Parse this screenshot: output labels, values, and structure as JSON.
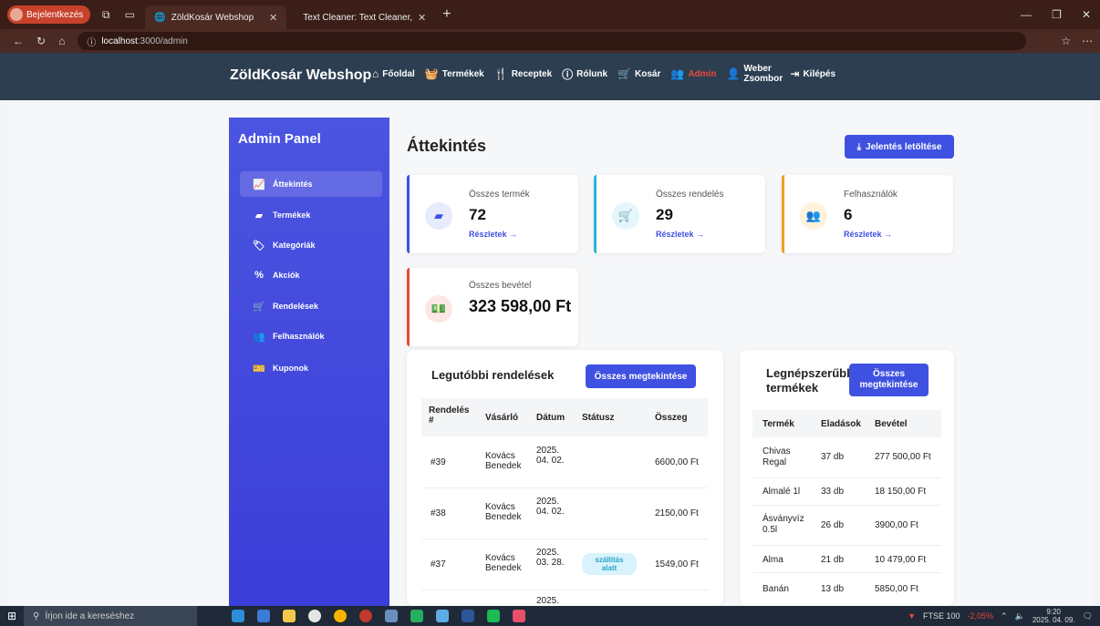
{
  "browser": {
    "profile_label": "Bejelentkezés",
    "tabs": [
      {
        "title": "ZöldKosár Webshop",
        "active": true
      },
      {
        "title": "Text Cleaner: Text Cleaner, Text Fo",
        "active": false
      }
    ],
    "url_host": "localhost",
    "url_path": ":3000/admin"
  },
  "navbar": {
    "brand": "ZöldKosár Webshop",
    "links": [
      {
        "label": "Főoldal",
        "icon": "home-icon"
      },
      {
        "label": "Termékek",
        "icon": "basket-icon"
      },
      {
        "label": "Receptek",
        "icon": "utensils-icon"
      },
      {
        "label": "Rólunk",
        "icon": "info-icon"
      },
      {
        "label": "Kosár",
        "icon": "cart-icon"
      },
      {
        "label": "Admin",
        "icon": "users-cog-icon"
      },
      {
        "label": "Weber Zsombor",
        "icon": "user-icon"
      },
      {
        "label": "Kilépés",
        "icon": "logout-icon"
      }
    ],
    "admin_color": "#e74c3c"
  },
  "sidebar": {
    "title": "Admin Panel",
    "items": [
      {
        "label": "Áttekintés",
        "icon": "chart-line-icon",
        "active": true
      },
      {
        "label": "Termékek",
        "icon": "box-icon",
        "active": false
      },
      {
        "label": "Kategóriák",
        "icon": "tags-icon",
        "active": false
      },
      {
        "label": "Akciók",
        "icon": "percent-icon",
        "active": false
      },
      {
        "label": "Rendelések",
        "icon": "cart-icon",
        "active": false
      },
      {
        "label": "Felhasználók",
        "icon": "users-icon",
        "active": false
      },
      {
        "label": "Kuponok",
        "icon": "ticket-icon",
        "active": false
      }
    ]
  },
  "main": {
    "title": "Áttekintés",
    "report_button": "Jelentés letöltése",
    "stats": [
      {
        "label": "Összes termék",
        "value": "72",
        "link": "Részletek →",
        "color": "#3f51e0",
        "icon": "box-icon"
      },
      {
        "label": "Összes rendelés",
        "value": "29",
        "link": "Részletek →",
        "color": "#2bb6d9",
        "icon": "cart-icon"
      },
      {
        "label": "Felhasználók",
        "value": "6",
        "link": "Részletek →",
        "color": "#f0a020",
        "icon": "users-icon"
      },
      {
        "label": "Összes bevétel",
        "value": "323 598,00 Ft",
        "color": "#e74c3c",
        "icon": "money-icon"
      }
    ]
  },
  "recent_orders": {
    "title": "Legutóbbi rendelések",
    "button": "Összes megtekintése",
    "columns": [
      "Rendelés #",
      "Vásárló",
      "Dátum",
      "Státusz",
      "Összeg"
    ],
    "rows": [
      {
        "id": "#39",
        "customer": "Kovács Benedek",
        "date": "2025. 04. 02.",
        "status": "",
        "amount": "6600,00 Ft"
      },
      {
        "id": "#38",
        "customer": "Kovács Benedek",
        "date": "2025. 04. 02.",
        "status": "",
        "amount": "2150,00 Ft"
      },
      {
        "id": "#37",
        "customer": "Kovács Benedek",
        "date": "2025. 03. 28.",
        "status": "szállítás alatt",
        "amount": "1549,00 Ft"
      },
      {
        "id": "",
        "customer": "",
        "date": "2025.",
        "status": "",
        "amount": ""
      }
    ]
  },
  "popular_products": {
    "title": "Legnépszerűbb termékek",
    "button": "Összes megtekintése",
    "columns": [
      "Termék",
      "Eladások",
      "Bevétel"
    ],
    "rows": [
      {
        "name": "Chivas Regal",
        "sales": "37 db",
        "revenue": "277 500,00 Ft"
      },
      {
        "name": "Almalé 1l",
        "sales": "33 db",
        "revenue": "18 150,00 Ft"
      },
      {
        "name": "Ásványvíz 0.5l",
        "sales": "26 db",
        "revenue": "3900,00 Ft"
      },
      {
        "name": "Alma",
        "sales": "21 db",
        "revenue": "10 479,00 Ft"
      },
      {
        "name": "Banán",
        "sales": "13 db",
        "revenue": "5850,00 Ft"
      }
    ]
  },
  "taskbar": {
    "search_placeholder": "Írjon ide a kereséshez",
    "ticker_name": "FTSE 100",
    "ticker_change": "-2,05%",
    "time": "9:20",
    "date": "2025. 04. 09."
  }
}
